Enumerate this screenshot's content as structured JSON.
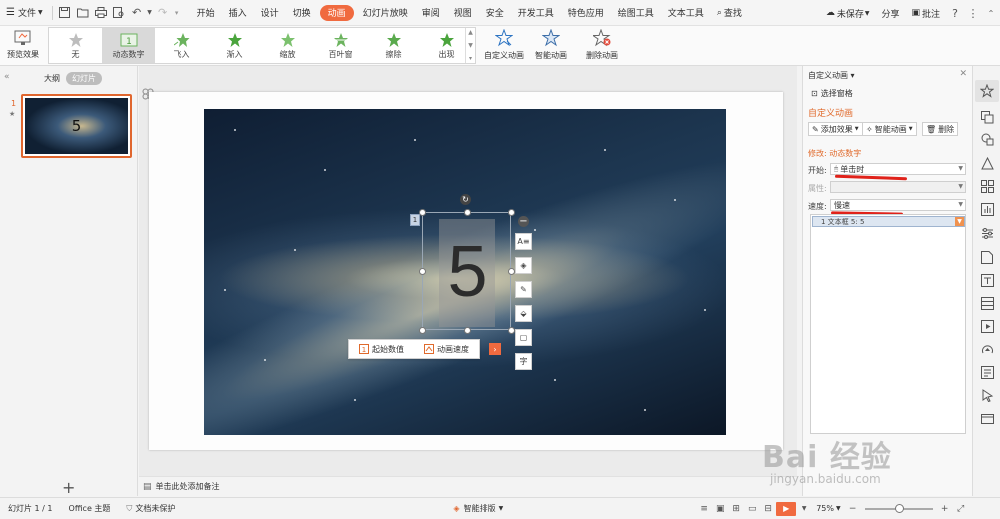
{
  "menubar": {
    "file_label": "文件",
    "tabs": [
      {
        "label": "开始",
        "active": false
      },
      {
        "label": "插入",
        "active": false
      },
      {
        "label": "设计",
        "active": false
      },
      {
        "label": "切换",
        "active": false
      },
      {
        "label": "动画",
        "active": true
      },
      {
        "label": "幻灯片放映",
        "active": false
      },
      {
        "label": "审阅",
        "active": false
      },
      {
        "label": "视图",
        "active": false
      },
      {
        "label": "安全",
        "active": false
      },
      {
        "label": "开发工具",
        "active": false
      },
      {
        "label": "特色应用",
        "active": false
      },
      {
        "label": "绘图工具",
        "active": false
      },
      {
        "label": "文本工具",
        "active": false
      }
    ],
    "search_label": "查找",
    "unsaved_label": "未保存",
    "share_label": "分享",
    "comment_label": "批注",
    "accent_color": "#f06a3f"
  },
  "ribbon": {
    "preview_label": "预览效果",
    "gallery": [
      {
        "label": "无",
        "selected": false
      },
      {
        "label": "动态数字",
        "selected": true
      },
      {
        "label": "飞入",
        "selected": false
      },
      {
        "label": "渐入",
        "selected": false
      },
      {
        "label": "缩放",
        "selected": false
      },
      {
        "label": "百叶窗",
        "selected": false
      },
      {
        "label": "擦除",
        "selected": false
      },
      {
        "label": "出现",
        "selected": false
      }
    ],
    "custom_anim_label": "自定义动画",
    "smart_anim_label": "智能动画",
    "delete_anim_label": "删除动画"
  },
  "left_panel": {
    "tab_outline": "大纲",
    "tab_slides": "幻灯片",
    "slide_number": "1",
    "thumb_text": "5"
  },
  "slide": {
    "number_text": "5",
    "anim_badge": "1",
    "popbar": {
      "start_value_label": "起始数值",
      "speed_label": "动画速度"
    }
  },
  "notes": {
    "placeholder": "单击此处添加备注"
  },
  "task_pane": {
    "title": "自定义动画",
    "select_pane_label": "选择窗格",
    "section_title": "自定义动画",
    "add_effect_label": "添加效果",
    "smart_anim_label": "智能动画",
    "delete_label": "删除",
    "modify_label": "修改: 动态数字",
    "start_label": "开始:",
    "start_value": "单击时",
    "property_label": "属性:",
    "speed_label": "速度:",
    "speed_value": "慢速",
    "list_item": "1   文本框 5: 5"
  },
  "status": {
    "slide_info": "幻灯片 1 / 1",
    "theme": "Office 主题",
    "protect": "文档未保护",
    "smart_layout": "智能排版",
    "zoom": "75%"
  },
  "watermark": {
    "logo": "Bai 经验",
    "url": "jingyan.baidu.com"
  }
}
